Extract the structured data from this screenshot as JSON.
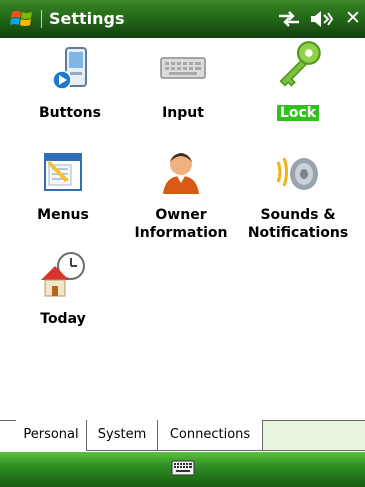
{
  "window": {
    "title": "Settings"
  },
  "items": [
    {
      "label": "Buttons",
      "icon": "buttons-pda-icon"
    },
    {
      "label": "Input",
      "icon": "keyboard-icon"
    },
    {
      "label": "Lock",
      "icon": "key-icon",
      "selected": true
    },
    {
      "label": "Menus",
      "icon": "menus-icon"
    },
    {
      "label_line1": "Owner",
      "label_line2": "Information",
      "icon": "owner-icon"
    },
    {
      "label_line1": "Sounds &",
      "label_line2": "Notifications",
      "icon": "speaker-icon"
    },
    {
      "label": "Today",
      "icon": "today-house-clock-icon"
    }
  ],
  "tabs": [
    {
      "label": "Personal",
      "active": true
    },
    {
      "label": "System",
      "active": false
    },
    {
      "label": "Connections",
      "active": false
    }
  ],
  "colors": {
    "title_bar": "#2f7a20",
    "selection": "#2fc21c",
    "bottom_bar": "#2f8f22"
  }
}
